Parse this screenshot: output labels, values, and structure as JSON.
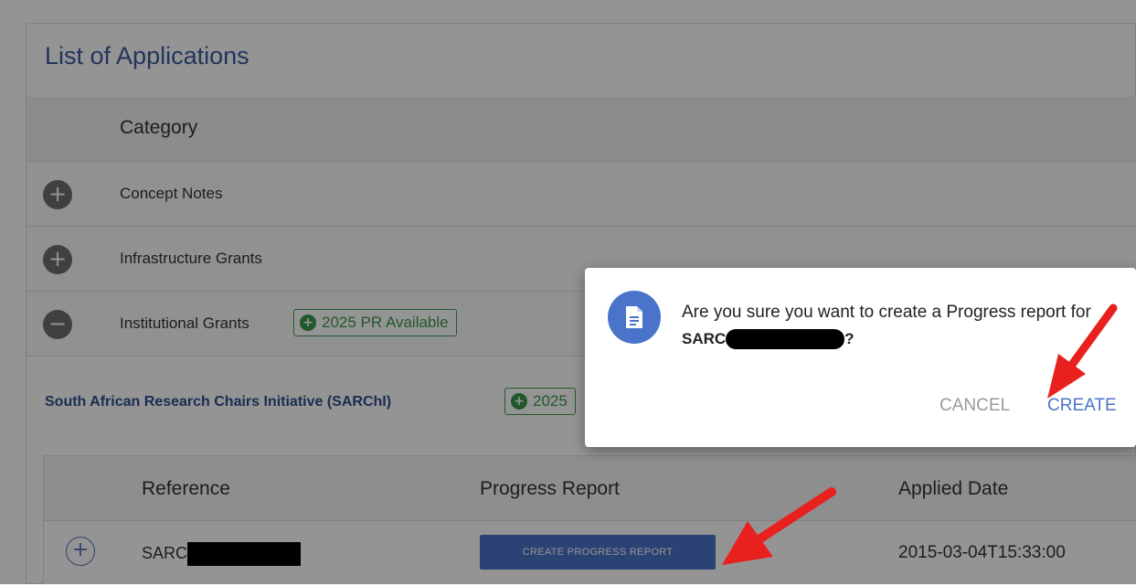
{
  "panel": {
    "title": "List of Applications",
    "category_header": "Category"
  },
  "categories": [
    {
      "label": "Concept Notes",
      "toggle": "+",
      "expanded": false
    },
    {
      "label": "Infrastructure Grants",
      "toggle": "+",
      "expanded": false
    },
    {
      "label": "Institutional Grants",
      "toggle": "−",
      "expanded": true,
      "badge": "2025 PR Available"
    }
  ],
  "program": {
    "title": "South African Research Chairs Initiative (SARChI)",
    "badge": "2025"
  },
  "table": {
    "headers": [
      "Reference",
      "Progress Report",
      "Applied Date"
    ],
    "rows": [
      {
        "reference": "SARC",
        "action_label": "CREATE PROGRESS REPORT",
        "applied_date": "2015-03-04T15:33:00"
      }
    ]
  },
  "dialog": {
    "message": "Are you sure you want to create a Progress report for",
    "reference": "SARC",
    "suffix": "?",
    "cancel_label": "CANCEL",
    "create_label": "CREATE"
  },
  "colors": {
    "accent": "#4a74c9",
    "title": "#3b5c9e",
    "badge_green": "#3c9a4a",
    "annotation_red": "#e8211f"
  },
  "icons": {
    "dialog": "document-icon",
    "badge": "plus-circle-icon",
    "toggle_collapsed": "plus-circle-icon",
    "toggle_expanded": "minus-circle-icon"
  }
}
